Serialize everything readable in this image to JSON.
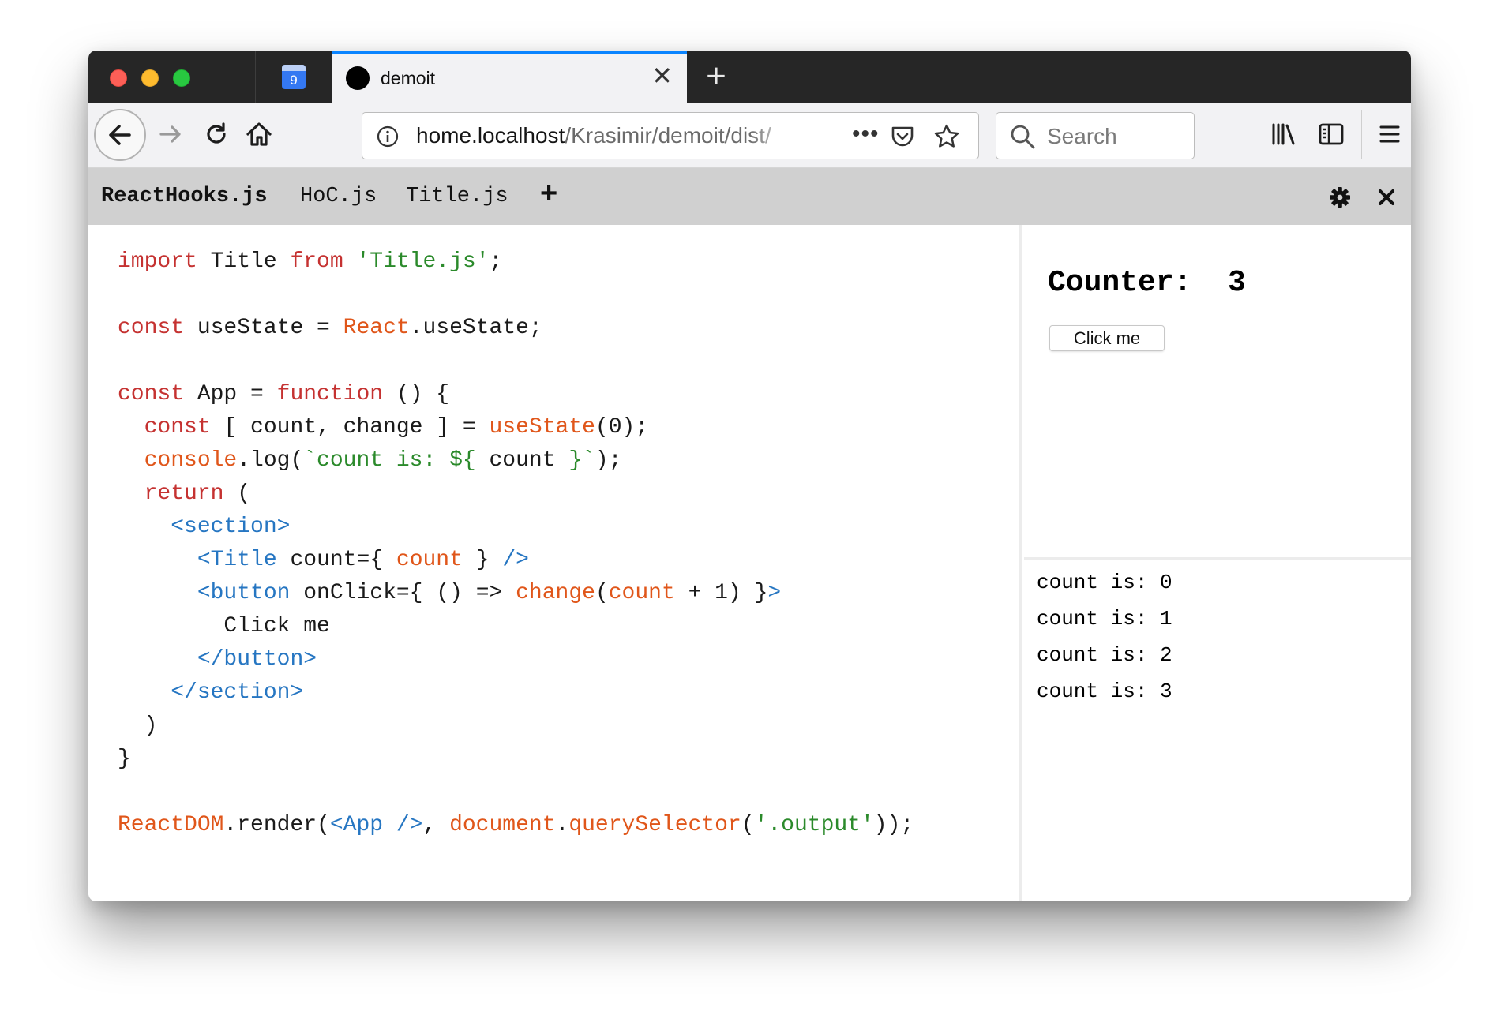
{
  "browser": {
    "tabs": [
      {
        "label": "9",
        "icon": "calendar-icon"
      },
      {
        "label": "demoit",
        "active": true
      }
    ],
    "url": {
      "host": "home.localhost",
      "path": "/Krasimir/demoit/dist/"
    },
    "search_placeholder": "Search"
  },
  "editor": {
    "files": [
      "ReactHooks.js",
      "HoC.js",
      "Title.js"
    ],
    "active_file": "ReactHooks.js",
    "code": [
      [
        [
          "k",
          "import"
        ],
        [
          "n",
          " Title "
        ],
        [
          "k",
          "from"
        ],
        [
          "n",
          " "
        ],
        [
          "s",
          "'Title.js'"
        ],
        [
          "n",
          ";"
        ]
      ],
      [],
      [
        [
          "k",
          "const"
        ],
        [
          "n",
          " useState = "
        ],
        [
          "b",
          "React"
        ],
        [
          "n",
          ".useState;"
        ]
      ],
      [],
      [
        [
          "k",
          "const"
        ],
        [
          "n",
          " App = "
        ],
        [
          "k",
          "function"
        ],
        [
          "n",
          " () {"
        ]
      ],
      [
        [
          "n",
          "  "
        ],
        [
          "k",
          "const"
        ],
        [
          "n",
          " [ count, change ] = "
        ],
        [
          "b",
          "useState"
        ],
        [
          "n",
          "(0);"
        ]
      ],
      [
        [
          "n",
          "  "
        ],
        [
          "b",
          "console"
        ],
        [
          "n",
          ".log("
        ],
        [
          "s",
          "`count is: ${"
        ],
        [
          "n",
          " count "
        ],
        [
          "s",
          "}`"
        ],
        [
          "n",
          ");"
        ]
      ],
      [
        [
          "n",
          "  "
        ],
        [
          "k",
          "return"
        ],
        [
          "n",
          " ("
        ]
      ],
      [
        [
          "n",
          "    "
        ],
        [
          "t",
          "<section>"
        ]
      ],
      [
        [
          "n",
          "      "
        ],
        [
          "t",
          "<Title"
        ],
        [
          "n",
          " count={ "
        ],
        [
          "b",
          "count"
        ],
        [
          "n",
          " } "
        ],
        [
          "t",
          "/>"
        ]
      ],
      [
        [
          "n",
          "      "
        ],
        [
          "t",
          "<button"
        ],
        [
          "n",
          " onClick={ () => "
        ],
        [
          "b",
          "change"
        ],
        [
          "n",
          "("
        ],
        [
          "b",
          "count"
        ],
        [
          "n",
          " + 1) }"
        ],
        [
          "t",
          ">"
        ]
      ],
      [
        [
          "n",
          "        Click me"
        ]
      ],
      [
        [
          "n",
          "      "
        ],
        [
          "t",
          "</button>"
        ]
      ],
      [
        [
          "n",
          "    "
        ],
        [
          "t",
          "</section>"
        ]
      ],
      [
        [
          "n",
          "  )"
        ]
      ],
      [
        [
          "n",
          "}"
        ]
      ],
      [],
      [
        [
          "b",
          "ReactDOM"
        ],
        [
          "n",
          ".render("
        ],
        [
          "t",
          "<App />"
        ],
        [
          "n",
          ", "
        ],
        [
          "b",
          "document"
        ],
        [
          "n",
          "."
        ],
        [
          "b",
          "querySelector"
        ],
        [
          "n",
          "("
        ],
        [
          "s",
          "'.output'"
        ],
        [
          "n",
          "));"
        ]
      ]
    ]
  },
  "preview": {
    "heading": "Counter:  3",
    "button_label": "Click me"
  },
  "console": [
    "count is: 0",
    "count is: 1",
    "count is: 2",
    "count is: 3"
  ],
  "colors": {
    "keyword": "#c53231",
    "string": "#2b8a2b",
    "builtin": "#e0561a",
    "tag": "#2676c2",
    "tab_accent": "#0a84ff"
  }
}
